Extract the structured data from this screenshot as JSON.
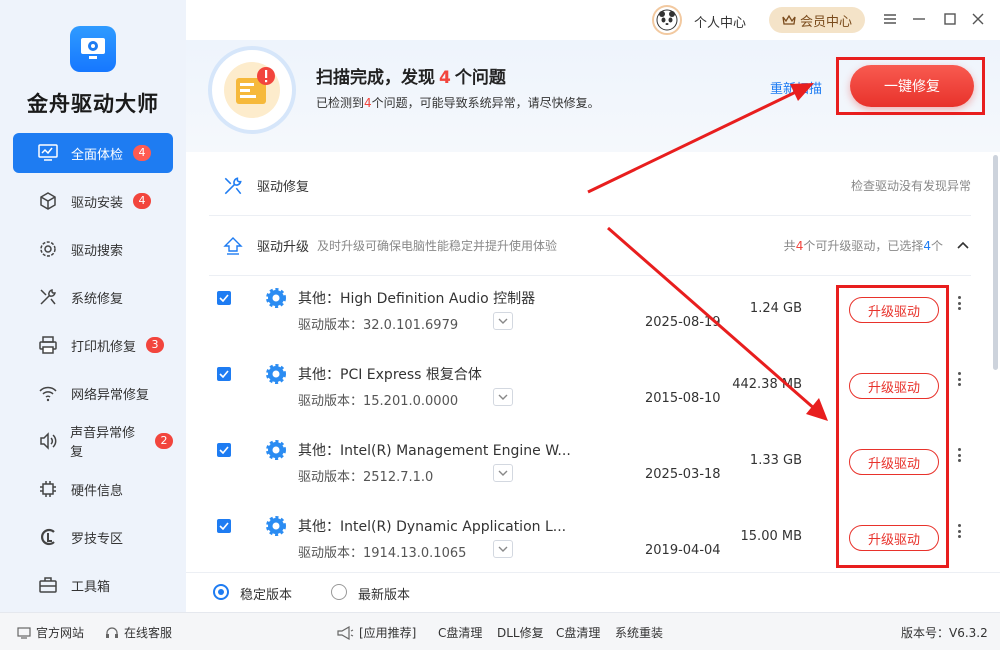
{
  "app": {
    "title": "金舟驱动大师"
  },
  "sidebar": {
    "items": [
      {
        "label": "全面体检",
        "badge": "4",
        "icon": "monitor-icon"
      },
      {
        "label": "驱动安装",
        "badge": "4",
        "icon": "package-icon"
      },
      {
        "label": "驱动搜索",
        "badge": "",
        "icon": "gear-search-icon"
      },
      {
        "label": "系统修复",
        "badge": "",
        "icon": "tools-icon"
      },
      {
        "label": "打印机修复",
        "badge": "3",
        "icon": "printer-icon"
      },
      {
        "label": "网络异常修复",
        "badge": "",
        "icon": "wifi-icon"
      },
      {
        "label": "声音异常修复",
        "badge": "2",
        "icon": "speaker-icon"
      },
      {
        "label": "硬件信息",
        "badge": "",
        "icon": "chip-icon"
      },
      {
        "label": "罗技专区",
        "badge": "",
        "icon": "logitech-icon"
      },
      {
        "label": "工具箱",
        "badge": "",
        "icon": "toolbox-icon"
      }
    ]
  },
  "topbar": {
    "personal": "个人中心",
    "vip": "会员中心"
  },
  "header": {
    "title_pre": "扫描完成，发现",
    "title_count": "4",
    "title_post": "个问题",
    "sub_pre": "已检测到",
    "sub_count": "4",
    "sub_post": "个问题，可能导致系统异常，请尽快修复。",
    "rescan": "重新扫描",
    "fix_all": "一键修复"
  },
  "sections": {
    "repair": {
      "title": "驱动修复",
      "right": "检查驱动没有发现异常"
    },
    "upgrade": {
      "title": "驱动升级",
      "desc": "及时升级可确保电脑性能稳定并提升使用体验",
      "right_pre": "共",
      "right_count": "4",
      "right_mid": "个可升级驱动，已选择",
      "right_sel": "4",
      "right_post": "个"
    }
  },
  "drivers": [
    {
      "name": "其他：High Definition Audio 控制器",
      "version": "驱动版本：32.0.101.6979",
      "date": "2025-08-19",
      "size": "1.24 GB",
      "action": "升级驱动"
    },
    {
      "name": "其他：PCI Express 根复合体",
      "version": "驱动版本：15.201.0.0000",
      "date": "2015-08-10",
      "size": "442.38 MB",
      "action": "升级驱动"
    },
    {
      "name": "其他：Intel(R) Management Engine W...",
      "version": "驱动版本：2512.7.1.0",
      "date": "2025-03-18",
      "size": "1.33 GB",
      "action": "升级驱动"
    },
    {
      "name": "其他：Intel(R) Dynamic Application L...",
      "version": "驱动版本：1914.13.0.1065",
      "date": "2019-04-04",
      "size": "15.00 MB",
      "action": "升级驱动"
    }
  ],
  "version_choice": {
    "stable": "稳定版本",
    "latest": "最新版本",
    "selected": "stable"
  },
  "footer": {
    "website": "官方网站",
    "support": "在线客服",
    "apps": "[应用推荐]",
    "links": [
      "C盘清理",
      "DLL修复",
      "C盘清理",
      "系统重装"
    ],
    "version": "版本号：V6.3.2"
  },
  "colors": {
    "accent": "#1e7cf2",
    "danger": "#f2453d",
    "highlight": "#e81e1e"
  }
}
